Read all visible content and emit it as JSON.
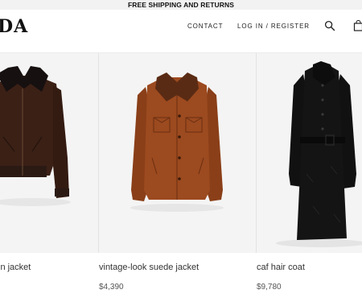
{
  "promo": {
    "text": "FREE SHIPPING AND RETURNS"
  },
  "header": {
    "logo_text": "DA",
    "nav": {
      "contact_label": "CONTACT",
      "login_label": "LOG IN / REGISTER"
    },
    "icons": [
      "search-icon",
      "shopping-bag-icon"
    ]
  },
  "products": [
    {
      "name": "in jacket",
      "price": ""
    },
    {
      "name": "vintage-look suede jacket",
      "price": "$4,390"
    },
    {
      "name": "caf hair coat",
      "price": "$9,780"
    }
  ],
  "colors": {
    "promo_bg": "#f2f2f2",
    "cell_bg": "#f4f4f4",
    "jacket_brown_dark": "#3b2016",
    "jacket_suede": "#9c4a1f",
    "coat_black": "#141414"
  }
}
